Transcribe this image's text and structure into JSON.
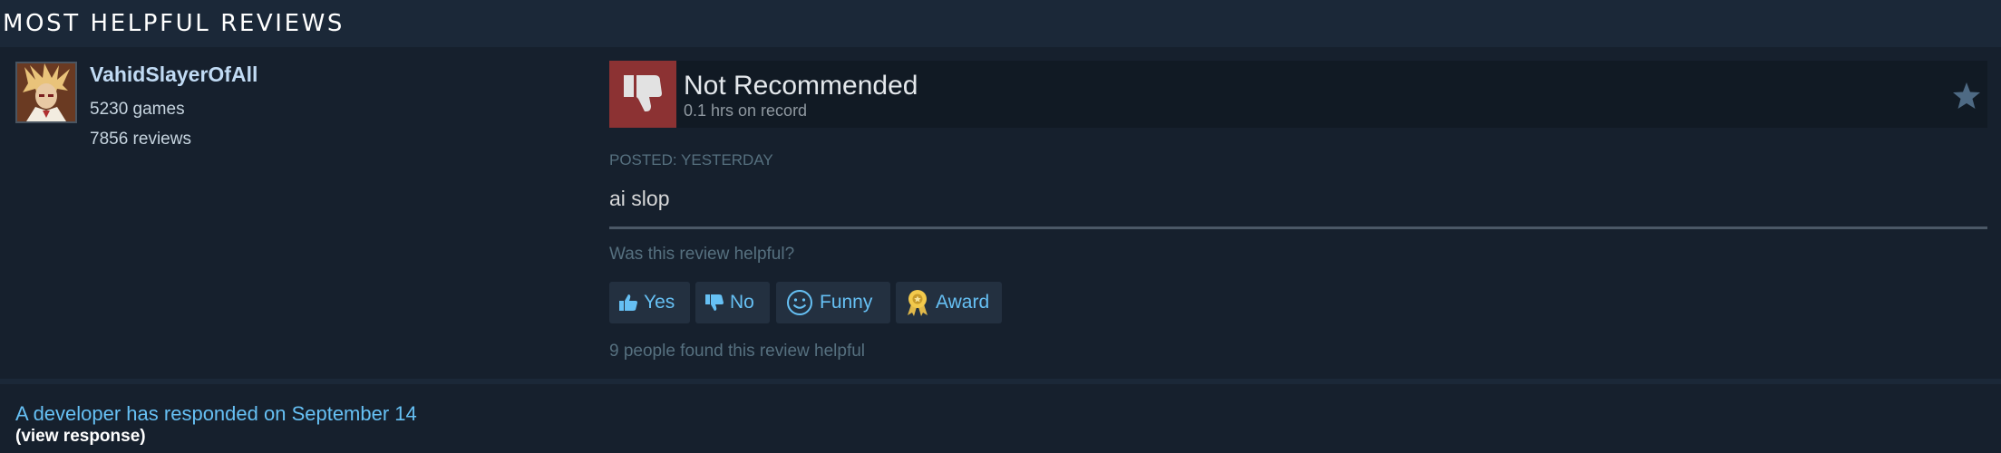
{
  "section": {
    "title": "MOST HELPFUL REVIEWS"
  },
  "reviewer": {
    "name": "VahidSlayerOfAll",
    "games": "5230 games",
    "reviews": "7856 reviews"
  },
  "review": {
    "verdict": "Not Recommended",
    "hours": "0.1 hrs on record",
    "posted": "POSTED: YESTERDAY",
    "content": "ai slop",
    "helpful_question": "Was this review helpful?",
    "helpful_count": "9 people found this review helpful"
  },
  "buttons": {
    "yes": "Yes",
    "no": "No",
    "funny": "Funny",
    "award": "Award"
  },
  "developer": {
    "link": "A developer has responded on September 14",
    "view": "(view response)"
  },
  "colors": {
    "background": "#1b2838",
    "panel": "#16202d",
    "thumb_down_red": "#8c3233",
    "link_blue": "#66c0f4"
  },
  "icons": [
    "thumbs-down-icon",
    "star-icon",
    "thumbs-up-icon",
    "smiley-icon",
    "award-icon"
  ]
}
